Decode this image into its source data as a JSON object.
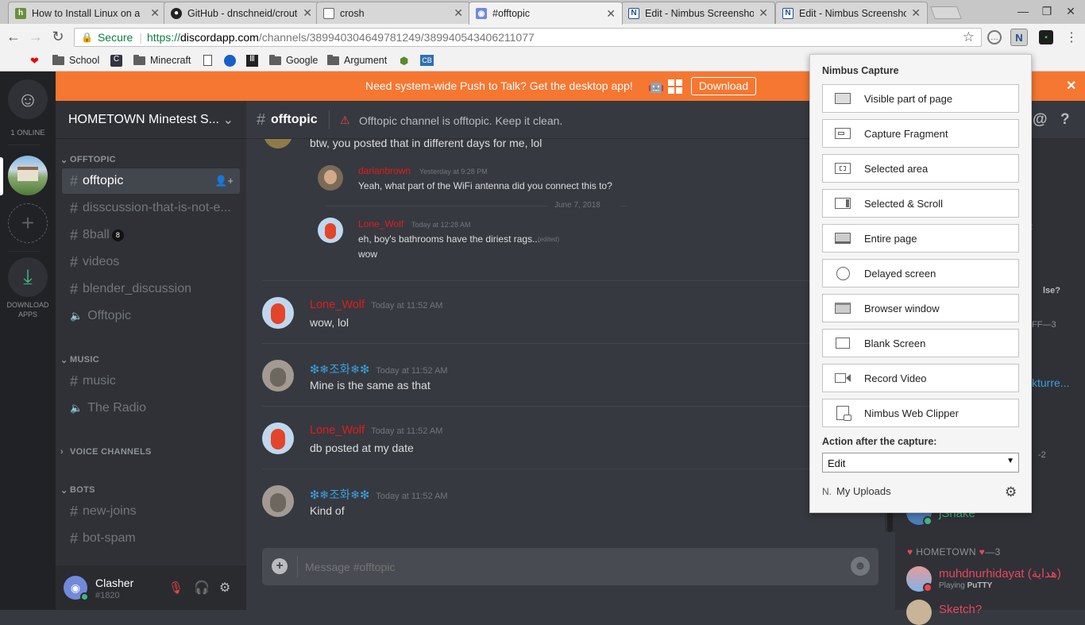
{
  "browser": {
    "tabs": [
      {
        "title": "How to Install Linux on a",
        "icon": "hackaday-icon"
      },
      {
        "title": "GitHub - dnschneid/crouton",
        "icon": "github-icon"
      },
      {
        "title": "crosh",
        "icon": "page-icon"
      },
      {
        "title": "#offtopic",
        "icon": "discord-icon"
      },
      {
        "title": "Edit - Nimbus Screenshot",
        "icon": "nimbus-icon"
      },
      {
        "title": "Edit - Nimbus Screenshot",
        "icon": "nimbus-icon"
      }
    ],
    "url": {
      "secure_label": "Secure",
      "scheme": "https://",
      "host": "discordapp.com",
      "path": "/channels/389940304649781249/389940543406211077"
    },
    "bookmarks": [
      {
        "label": "",
        "icon": "youtube-icon"
      },
      {
        "label": "School",
        "icon": "folder-icon"
      },
      {
        "label": "",
        "icon": "clever-icon"
      },
      {
        "label": "Minecraft",
        "icon": "folder-icon"
      },
      {
        "label": "",
        "icon": "page-icon"
      },
      {
        "label": "",
        "icon": "chrome-web-icon"
      },
      {
        "label": "",
        "icon": "library-icon"
      },
      {
        "label": "Google",
        "icon": "folder-icon"
      },
      {
        "label": "Argument",
        "icon": "folder-icon"
      },
      {
        "label": "",
        "icon": "turtle-icon"
      },
      {
        "label": "CB",
        "icon": "cb-icon"
      }
    ]
  },
  "discord": {
    "online_count": "1 ONLINE",
    "download_apps": "DOWNLOAD APPS",
    "banner": {
      "text": "Need system-wide Push to Talk? Get the desktop app!",
      "button": "Download"
    },
    "server_name": "HOMETOWN Minetest S...",
    "categories": [
      {
        "name": "OFFTOPIC",
        "channels": [
          {
            "name": "offtopic",
            "type": "text",
            "active": true
          },
          {
            "name": "disscussion-that-is-not-e...",
            "type": "text"
          },
          {
            "name": "8ball",
            "type": "text",
            "emoji": "8"
          },
          {
            "name": "videos",
            "type": "text"
          },
          {
            "name": "blender_discussion",
            "type": "text"
          },
          {
            "name": "Offtopic",
            "type": "voice"
          }
        ]
      },
      {
        "name": "MUSIC",
        "channels": [
          {
            "name": "music",
            "type": "text"
          },
          {
            "name": "The Radio",
            "type": "voice"
          }
        ]
      },
      {
        "name": "VOICE CHANNELS",
        "channels": []
      },
      {
        "name": "BOTS",
        "channels": [
          {
            "name": "new-joins",
            "type": "text"
          },
          {
            "name": "bot-spam",
            "type": "text"
          }
        ]
      }
    ],
    "user": {
      "name": "Clasher",
      "tag": "#1820"
    },
    "channel_header": {
      "name": "offtopic",
      "topic": "Offtopic channel is offtopic. Keep it clean."
    },
    "messages": {
      "partial_text": "btw, you posted that in different days for me, lol",
      "blocked": [
        {
          "author": "darianbrown",
          "time": "Yesterday at 9:28 PM",
          "text": "Yeah, what part of the WiFi antenna did you connect this to?"
        },
        {
          "author": "Lone_Wolf",
          "time": "Today at 12:28 AM",
          "text": "eh, boy's bathrooms have the diriest rags...",
          "edited": "(edited)",
          "text2": "wow"
        }
      ],
      "divider": "June 7, 2018",
      "list": [
        {
          "author": "Lone_Wolf",
          "time": "Today at 11:52 AM",
          "text": "wow, lol",
          "color": "#e21c1c"
        },
        {
          "author": "❇❄조화❄❇",
          "time": "Today at 11:52 AM",
          "text": "Mine is the same as that",
          "color": "#3ba0e0"
        },
        {
          "author": "Lone_Wolf",
          "time": "Today at 11:52 AM",
          "text": "db posted at my date",
          "color": "#e21c1c"
        },
        {
          "author": "❇❄조화❄❇",
          "time": "Today at 11:52 AM",
          "text": "Kind of",
          "color": "#3ba0e0"
        }
      ],
      "input_placeholder": "Message #offtopic"
    },
    "members": {
      "partial": [
        {
          "text": "2"
        },
        {
          "text": "lse?"
        },
        {
          "text": "FF—3"
        },
        {
          "text": "kturre..."
        },
        {
          "text": "-2"
        }
      ],
      "jsnake": "jSnake",
      "role": "HOMETOWN",
      "role_count": "—3",
      "member1": {
        "name": "muhdnurhidayat (هداية)",
        "activity_prefix": "Playing",
        "activity": "PuTTY"
      },
      "member2": "Sketch?"
    }
  },
  "nimbus": {
    "title": "Nimbus Capture",
    "options": [
      {
        "label": "Visible part of page",
        "icon": "visible-page-icon"
      },
      {
        "label": "Capture Fragment",
        "icon": "fragment-icon"
      },
      {
        "label": "Selected area",
        "icon": "selected-area-icon"
      },
      {
        "label": "Selected & Scroll",
        "icon": "select-scroll-icon"
      },
      {
        "label": "Entire page",
        "icon": "entire-page-icon"
      },
      {
        "label": "Delayed screen",
        "icon": "timer-icon"
      },
      {
        "label": "Browser window",
        "icon": "browser-window-icon"
      },
      {
        "label": "Blank Screen",
        "icon": "blank-screen-icon"
      },
      {
        "label": "Record Video",
        "icon": "video-camera-icon"
      },
      {
        "label": "Nimbus Web Clipper",
        "icon": "web-clipper-icon"
      }
    ],
    "action_label": "Action after the capture:",
    "action_value": "Edit",
    "uploads": "My Uploads"
  }
}
